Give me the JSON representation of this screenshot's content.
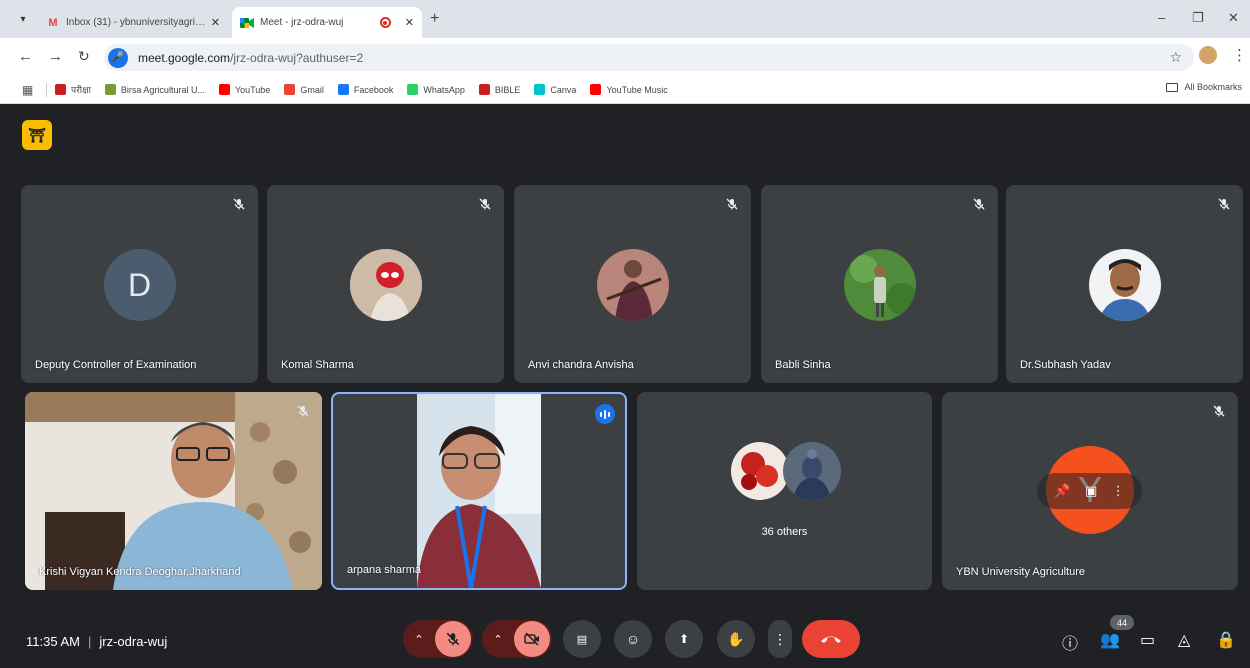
{
  "browser": {
    "tabs": [
      {
        "title": "Inbox (31) - ybnuniversityagric...",
        "favicon": "gmail-icon"
      },
      {
        "title": "Meet - jrz-odra-wuj",
        "favicon": "meet-icon",
        "active": true
      }
    ],
    "url_host": "meet.google.com",
    "url_path": "/jrz-odra-wuj?authuser=2",
    "bookmarks": [
      {
        "label": "परीक्षा",
        "color": "#c5221f"
      },
      {
        "label": "Birsa Agricultural U...",
        "color": "#7a9a3a"
      },
      {
        "label": "YouTube",
        "color": "#ff0000"
      },
      {
        "label": "Gmail",
        "color": "#ea4335"
      },
      {
        "label": "Facebook",
        "color": "#1877f2"
      },
      {
        "label": "WhatsApp",
        "color": "#25d366"
      },
      {
        "label": "BIBLE",
        "color": "#c5221f"
      },
      {
        "label": "Canva",
        "color": "#00c4cc"
      },
      {
        "label": "YouTube Music",
        "color": "#ff0000"
      }
    ],
    "all_bookmarks": "All Bookmarks"
  },
  "meet": {
    "participants_row1": [
      {
        "name": "Deputy Controller of Examination",
        "avatar_letter": "D"
      },
      {
        "name": "Komal Sharma"
      },
      {
        "name": "Anvi chandra Anvisha"
      },
      {
        "name": "Babli Sinha"
      },
      {
        "name": "Dr.Subhash Yadav"
      }
    ],
    "participants_row2": [
      {
        "name": "Krishi Vigyan Kendra Deoghar,Jharkhand"
      },
      {
        "name": "arpana sharma"
      },
      {
        "name": "36 others"
      },
      {
        "name": "YBN University Agriculture",
        "avatar_letter": "Y"
      }
    ],
    "time": "11:35 AM",
    "meeting_code": "jrz-odra-wuj",
    "participant_count": "44"
  },
  "colors": {
    "meet_bg": "#202124",
    "tile_bg": "#3c4043",
    "end_call": "#ea4335",
    "speaking": "#1a73e8",
    "ybn_avatar": "#f4511e"
  }
}
